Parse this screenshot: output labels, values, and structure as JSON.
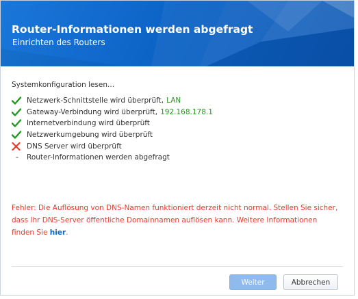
{
  "header": {
    "title": "Router-Informationen werden abgefragt",
    "subtitle": "Einrichten des Routers"
  },
  "checks": {
    "heading": "Systemkonfiguration lesen...",
    "items": [
      {
        "status": "success",
        "icon": "check-icon",
        "label": "Netzwerk-Schnittstelle wird überprüft,",
        "value": "LAN"
      },
      {
        "status": "success",
        "icon": "check-icon",
        "label": "Gateway-Verbindung wird überprüft,",
        "value": "192.168.178.1"
      },
      {
        "status": "success",
        "icon": "check-icon",
        "label": "Internetverbindung wird überprüft",
        "value": ""
      },
      {
        "status": "success",
        "icon": "check-icon",
        "label": "Netzwerkumgebung wird überprüft",
        "value": ""
      },
      {
        "status": "failed",
        "icon": "cross-icon",
        "label": "DNS Server wird überprüft",
        "value": ""
      },
      {
        "status": "pending",
        "icon": "dash",
        "label": "Router-Informationen werden abgefragt",
        "value": "",
        "marker": "-"
      }
    ]
  },
  "error": {
    "text": "Fehler: Die Auflösung von DNS-Namen funktioniert derzeit nicht normal. Stellen Sie sicher, dass Ihr DNS-Server öffentliche Domainnamen auflösen kann. Weitere Informationen finden Sie",
    "link_label": "hier",
    "suffix": "."
  },
  "buttons": {
    "next_label": "Weiter",
    "next_enabled": false,
    "cancel_label": "Abbrechen"
  },
  "colors": {
    "header_blue": "#0d64c7",
    "success_green": "#1e9a1e",
    "error_red": "#e53b2c",
    "link_blue": "#0c68c9",
    "next_button_disabled": "#8fbaee"
  }
}
